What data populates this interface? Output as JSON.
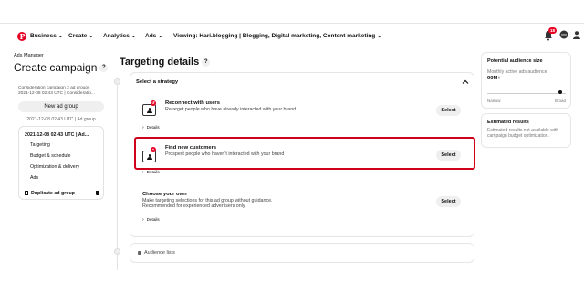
{
  "topnav": {
    "logo_letter": "P",
    "items": [
      {
        "label": "Business"
      },
      {
        "label": "Create"
      },
      {
        "label": "Analytics"
      },
      {
        "label": "Ads"
      }
    ],
    "viewing": "Viewing: Hari.blogging | Blogging, Digital marketing, Content marketing",
    "notification_count": "18",
    "chevron": "⌄"
  },
  "sidebar": {
    "subtitle": "Ads Manager",
    "title": "Create campaign",
    "help": "?",
    "campaign_line1": "Consideration campaign 2 ad groups",
    "campaign_line2": "2021-12-08 02:43 UTC | Consideratio...",
    "new_ad_group": "New ad group",
    "ad_group_date": "2021-12-08 02:43 UTC | Ad group",
    "card_title": "2021-12-08 02:43 UTC | Ad...",
    "links": [
      "Targeting",
      "Budget & schedule",
      "Optimization & delivery",
      "Ads"
    ],
    "duplicate": "Duplicate ad group"
  },
  "main": {
    "title": "Targeting details",
    "help": "?",
    "strategy_header": "Select a strategy",
    "options": [
      {
        "title": "Reconnect with users",
        "desc": "Retarget people who have already interacted with your brand",
        "details": "Details",
        "select": "Select"
      },
      {
        "title": "Find new customers",
        "desc": "Prospect people who haven't interacted with your brand",
        "details": "Details",
        "select": "Select"
      },
      {
        "title": "Choose your own",
        "desc": "Make targeting selections for this ad group without guidance. Recommended for experienced advertisers only.",
        "details": "Details",
        "select": "Select"
      }
    ],
    "audience_lists": "Audience lists"
  },
  "right": {
    "audience_title": "Potential audience size",
    "audience_sub": "Monthly active ads audience",
    "audience_value": "90M+",
    "audience_level": 0.93,
    "narrow": "Narrow",
    "broad": "Broad",
    "estimated_title": "Estimated results",
    "estimated_body": "Estimated results not available with campaign budget optimization."
  },
  "colors": {
    "brand": "#e60023",
    "highlight": "#d0021b"
  },
  "icons": [
    "pinterest-logo-icon",
    "bell-icon",
    "chat-icon",
    "user-icon",
    "help-icon",
    "person-icon",
    "copy-icon",
    "trash-icon",
    "lock-icon",
    "chevron-down-icon",
    "chevron-up-icon",
    "chevron-right-icon"
  ]
}
